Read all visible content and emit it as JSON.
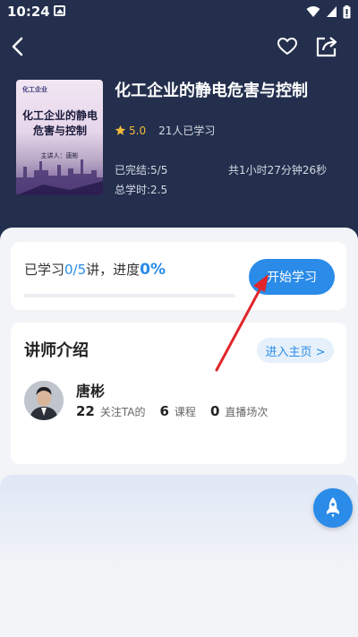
{
  "status_bar": {
    "time": "10:24",
    "icons": [
      "gallery-icon",
      "wifi-icon",
      "signal-icon",
      "battery-icon"
    ]
  },
  "header": {
    "back_icon": "back-icon",
    "favorite_icon": "heart-icon",
    "share_icon": "share-icon"
  },
  "course": {
    "cover": {
      "logo_text": "化工企业",
      "title": "化工企业的静电危害与控制",
      "speaker": "主讲人：唐彬"
    },
    "title": "化工企业的静电危害与控制",
    "rating": "5.0",
    "learners": "21人已学习",
    "completed": "已完结:5/5",
    "duration": "共1小时27分钟26秒",
    "total_hours": "总学时:2.5"
  },
  "progress": {
    "prefix": "已学习",
    "done": "0/5",
    "suffix": "讲，进度",
    "percent": "0%",
    "fraction": 0,
    "start_label": "开始学习"
  },
  "teacher": {
    "heading": "讲师介绍",
    "home_label": "进入主页 >",
    "name": "唐彬",
    "followers": "22",
    "followers_label": "关注TA的",
    "courses": "6",
    "courses_label": "课程",
    "lives": "0",
    "lives_label": "直播场次"
  },
  "colors": {
    "accent": "#2a8be8",
    "hero_bg": "#232f4d",
    "star": "#f3b93a",
    "annotation_arrow": "#e0262b"
  }
}
